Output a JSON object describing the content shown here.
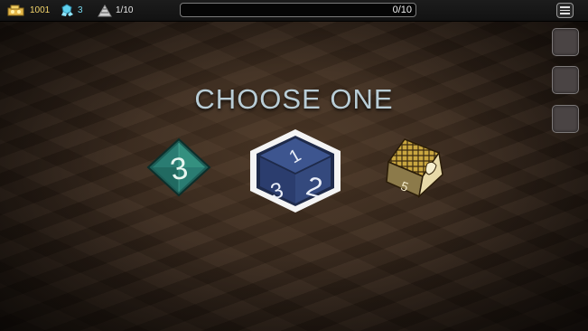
{
  "hud": {
    "gold": "1001",
    "gems": "3",
    "floor": "1/10",
    "progress_text": "0/10",
    "progress_fraction": 0,
    "icons": {
      "gold": "gold-coins-icon",
      "gems": "gems-icon",
      "floor": "pyramid-icon",
      "menu": "hamburger-menu-icon"
    }
  },
  "prompt": {
    "title": "CHOOSE ONE"
  },
  "dice": [
    {
      "name": "teal-d4",
      "label": "3",
      "color": "#1f6b62"
    },
    {
      "name": "blue-d6",
      "labels": [
        "1",
        "2",
        "3"
      ],
      "color": "#2a3a66",
      "selected": true
    },
    {
      "name": "gold-d6",
      "label": "5",
      "color": "#c9a640"
    }
  ],
  "colors": {
    "gold_text": "#f3d56b",
    "gem_text": "#78d9ef",
    "title": "#b9cdd6"
  }
}
